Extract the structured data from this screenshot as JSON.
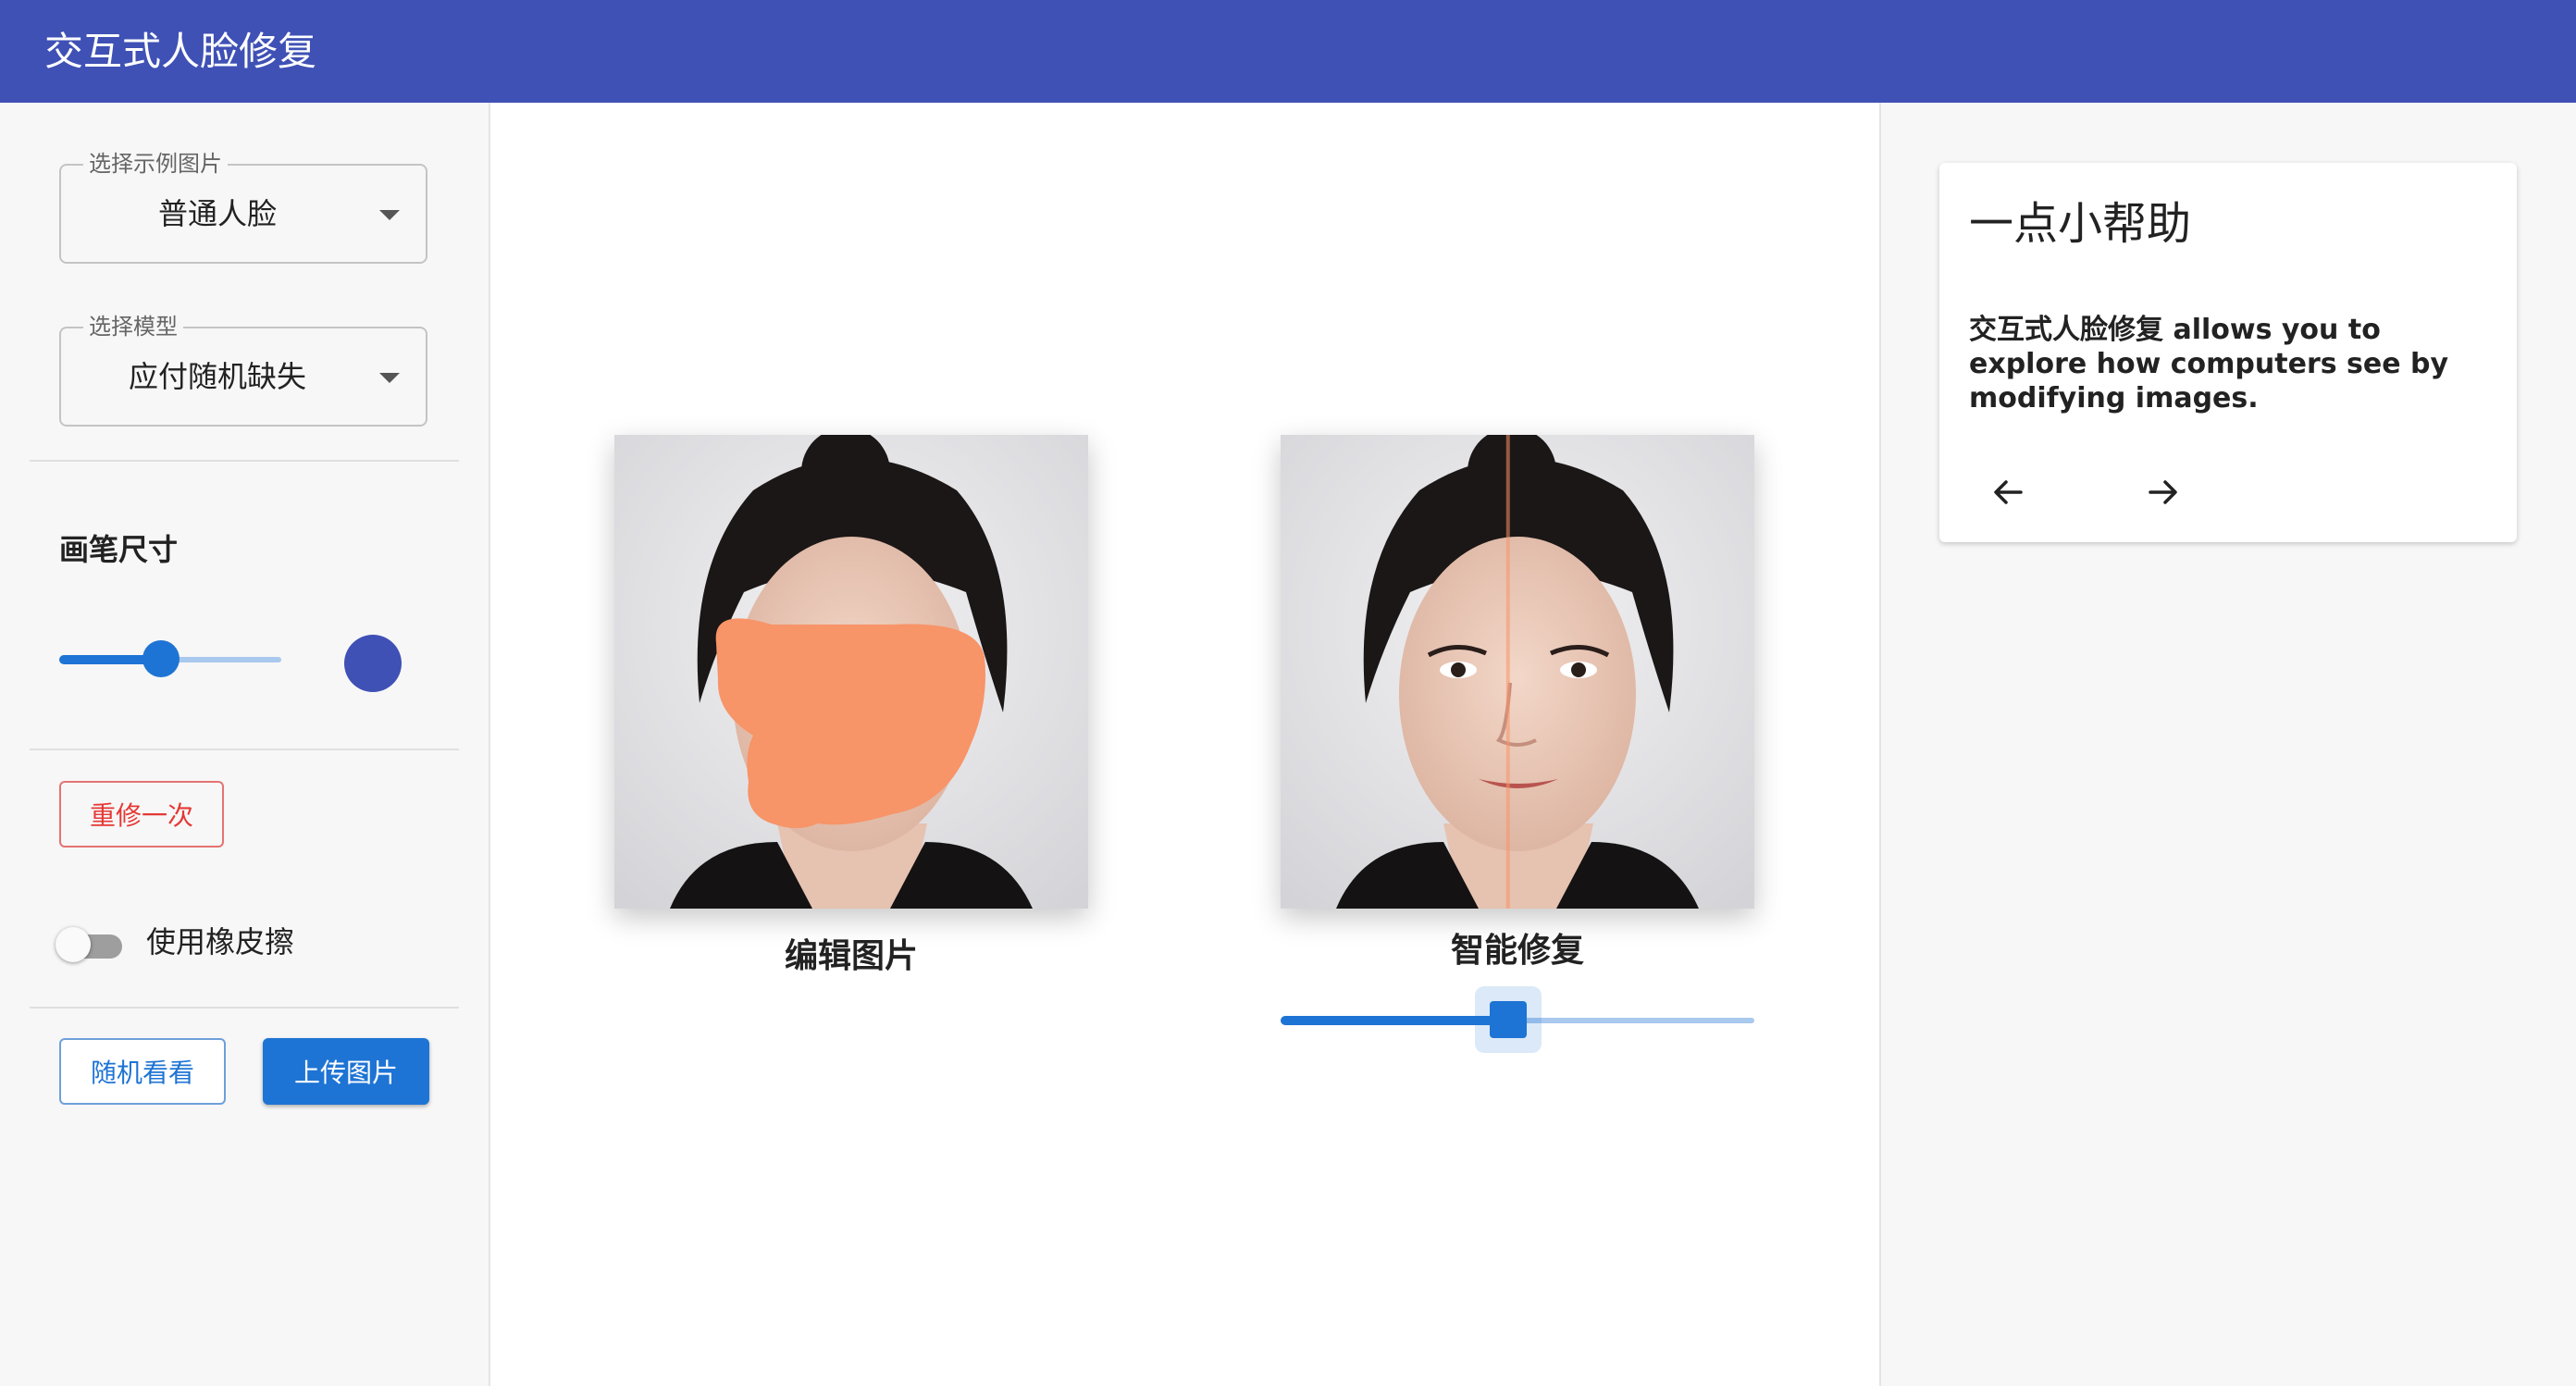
{
  "app": {
    "title": "交互式人脸修复"
  },
  "sidebar": {
    "example_select": {
      "label": "选择示例图片",
      "value": "普通人脸"
    },
    "model_select": {
      "label": "选择模型",
      "value": "应付随机缺失"
    },
    "brush": {
      "title": "画笔尺寸",
      "level_fraction": 0.46,
      "preview_color": "#3f51b5"
    },
    "redo_button": "重修一次",
    "eraser_toggle": {
      "label": "使用橡皮擦",
      "on": false
    },
    "random_button": "随机看看",
    "upload_button": "上传图片"
  },
  "main": {
    "edit_caption": "编辑图片",
    "result_caption": "智能修复",
    "compare_slider_fraction": 0.48,
    "mask_color": "#f79468"
  },
  "help": {
    "title": "一点小帮助",
    "body_bold": "交互式人脸修复",
    "body_rest": " allows you to explore how computers see by modifying images.",
    "prev_icon": "arrow-left-icon",
    "next_icon": "arrow-right-icon"
  },
  "colors": {
    "primary": "#3f51b5",
    "accent": "#1e74d4",
    "danger": "#e53935"
  }
}
